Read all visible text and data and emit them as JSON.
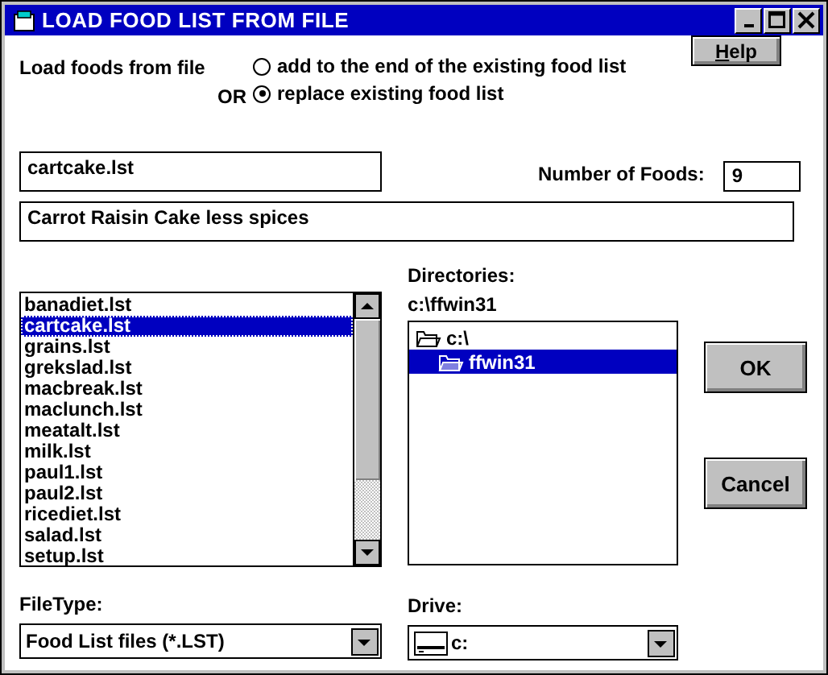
{
  "window": {
    "title": "LOAD FOOD LIST FROM FILE"
  },
  "help_button": {
    "label": "Help"
  },
  "load_label": "Load foods from file",
  "or_label": "OR",
  "load_options": [
    {
      "label": "add to the end of the existing food list",
      "selected": false
    },
    {
      "label": "replace existing food list",
      "selected": true
    }
  ],
  "file_name_field": {
    "value": "cartcake.lst"
  },
  "number_of_foods": {
    "label": "Number of Foods:",
    "value": "9"
  },
  "description_field": {
    "value": "Carrot Raisin Cake less spices"
  },
  "files": [
    {
      "label": "banadiet.lst",
      "selected": false
    },
    {
      "label": "cartcake.lst",
      "selected": true
    },
    {
      "label": "grains.lst",
      "selected": false
    },
    {
      "label": "grekslad.lst",
      "selected": false
    },
    {
      "label": "macbreak.lst",
      "selected": false
    },
    {
      "label": "maclunch.lst",
      "selected": false
    },
    {
      "label": "meatalt.lst",
      "selected": false
    },
    {
      "label": "milk.lst",
      "selected": false
    },
    {
      "label": "paul1.lst",
      "selected": false
    },
    {
      "label": "paul2.lst",
      "selected": false
    },
    {
      "label": "ricediet.lst",
      "selected": false
    },
    {
      "label": "salad.lst",
      "selected": false
    },
    {
      "label": "setup.lst",
      "selected": false
    }
  ],
  "directories": {
    "label": "Directories:",
    "path": "c:\\ffwin31",
    "tree": [
      {
        "label": "c:\\",
        "selected": false,
        "children": [
          {
            "label": "ffwin31",
            "selected": true
          }
        ]
      }
    ]
  },
  "file_type": {
    "label": "FileType:",
    "value": "Food List files (*.LST)"
  },
  "drive": {
    "label": "Drive:",
    "value": "c:"
  },
  "buttons": [
    {
      "label": "OK"
    },
    {
      "label": "Cancel"
    }
  ]
}
